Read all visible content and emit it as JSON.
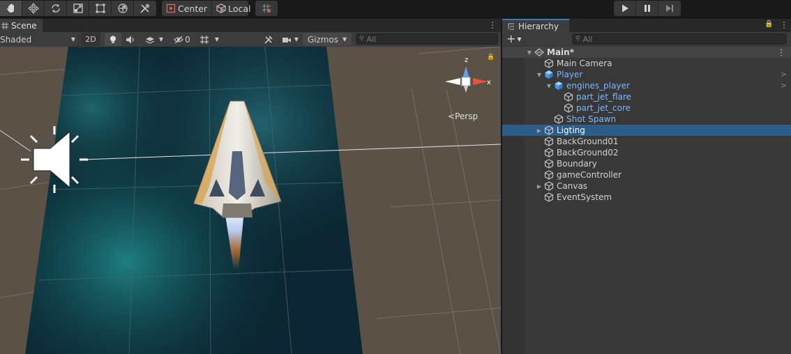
{
  "toolbar": {
    "tools": [
      {
        "name": "hand-tool-icon",
        "active": true
      },
      {
        "name": "move-tool-icon",
        "active": false
      },
      {
        "name": "rotate-tool-icon",
        "active": false
      },
      {
        "name": "scale-tool-icon",
        "active": false
      },
      {
        "name": "rect-tool-icon",
        "active": false
      },
      {
        "name": "transform-tool-icon",
        "active": false
      },
      {
        "name": "custom-tools-icon",
        "active": false
      }
    ],
    "pivot_mode_label": "Center",
    "pivot_rotation_label": "Local",
    "snap_icon": "grid-snap-icon",
    "play_controls": [
      "play-icon",
      "pause-icon",
      "step-icon"
    ]
  },
  "scene": {
    "tab_label": "Scene",
    "draw_mode": "Shaded",
    "mode_2d_label": "2D",
    "hidden_count": "0",
    "gizmos_label": "Gizmos",
    "search_placeholder": "All",
    "persp_label": "Persp",
    "axis_labels": {
      "y": "z",
      "x": "x"
    }
  },
  "hierarchy": {
    "tab_label": "Hierarchy",
    "search_placeholder": "All",
    "items": [
      {
        "label": "Main*",
        "depth": 0,
        "expander": "expanded",
        "type": "scene",
        "selected": false
      },
      {
        "label": "Main Camera",
        "depth": 1,
        "expander": "none",
        "type": "object",
        "selected": false
      },
      {
        "label": "Player",
        "depth": 1,
        "expander": "expanded",
        "type": "prefab",
        "selected": false,
        "has_chevron": true
      },
      {
        "label": "engines_player",
        "depth": 2,
        "expander": "expanded",
        "type": "prefab",
        "selected": false,
        "has_chevron": true
      },
      {
        "label": "part_jet_flare",
        "depth": 3,
        "expander": "none",
        "type": "prefab-child",
        "selected": false
      },
      {
        "label": "part_jet_core",
        "depth": 3,
        "expander": "none",
        "type": "prefab-child",
        "selected": false
      },
      {
        "label": "Shot Spawn",
        "depth": 2,
        "expander": "none",
        "type": "prefab-child",
        "selected": false
      },
      {
        "label": "Ligting",
        "depth": 1,
        "expander": "collapsed",
        "type": "object",
        "selected": true
      },
      {
        "label": "BackGround01",
        "depth": 1,
        "expander": "none",
        "type": "object",
        "selected": false
      },
      {
        "label": "BackGround02",
        "depth": 1,
        "expander": "none",
        "type": "object",
        "selected": false
      },
      {
        "label": "Boundary",
        "depth": 1,
        "expander": "none",
        "type": "object",
        "selected": false
      },
      {
        "label": "gameController",
        "depth": 1,
        "expander": "none",
        "type": "object",
        "selected": false
      },
      {
        "label": "Canvas",
        "depth": 1,
        "expander": "collapsed",
        "type": "object",
        "selected": false
      },
      {
        "label": "EventSystem",
        "depth": 1,
        "expander": "none",
        "type": "object",
        "selected": false
      }
    ]
  },
  "colors": {
    "selection": "#2c5d87",
    "prefab_text": "#7cb8ff",
    "accent_tab": "#3a79bb",
    "scene_background": "#5a5247"
  }
}
